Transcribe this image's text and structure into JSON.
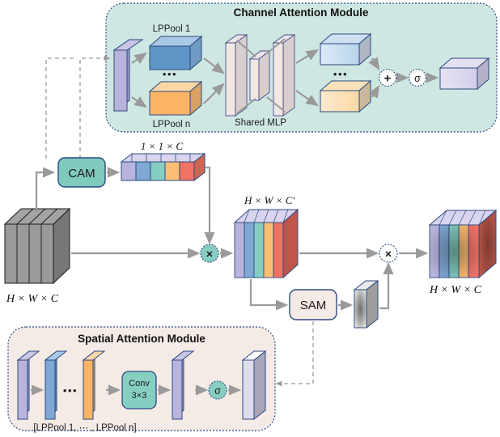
{
  "figure": {
    "kind": "neural-network-architecture-diagram",
    "name": "Attention module diagram (CAM + SAM)"
  },
  "channel_module": {
    "title": "Channel Attention Module",
    "pool_top_label": "LPPool 1",
    "pool_bottom_label": "LPPool n",
    "mlp_label": "Shared MLP",
    "ellipsis": "•••",
    "add_symbol": "+",
    "sigmoid_symbol": "σ",
    "bg_color": "#cfe7e2",
    "border_color": "#2b4a80"
  },
  "spatial_module": {
    "title": "Spatial Attention Module",
    "pool_list_label": "[LPPool 1, ⋯ , LPPool n]",
    "conv_label_line1": "Conv",
    "conv_label_line2": "3×3",
    "sigmoid_symbol": "σ",
    "ellipsis": "•••",
    "bg_color": "#f4eae6",
    "border_color": "#2b4a80"
  },
  "main_flow": {
    "input_label": "H × W × C",
    "cam_label": "CAM",
    "cam_vector_label": "1 × 1 × C",
    "mid_feature_label": "H × W × C'",
    "sam_label": "SAM",
    "output_label": "H × W × C",
    "multiply_symbol_1": "×",
    "multiply_symbol_2": "×"
  },
  "colors": {
    "cam_box_fill": "#7fc9bd",
    "sam_box_fill": "#f4eae6",
    "box_stroke": "#2b4a80",
    "arrow": "#9a9a9a",
    "dashed": "#9a9a9a",
    "input_block": "#8c8c8c",
    "channel_purple": "#b9b4dd",
    "channel_blue": "#7fa9d4",
    "channel_teal": "#86cec2",
    "channel_orange": "#fbbe74",
    "channel_red": "#ef7264",
    "slab_purple": "#b9b4dd",
    "slab_blue": "#6fa0cd",
    "slab_orange": "#f7b96a",
    "mlp_fill": "#f0e7e5"
  }
}
